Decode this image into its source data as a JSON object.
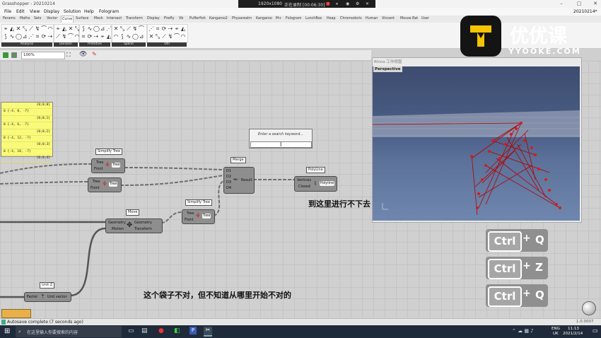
{
  "window": {
    "title": "Grasshopper - 20210214",
    "right_title": "20210214*"
  },
  "recording": {
    "resolution": "1920x1080",
    "status": "正在录制 [00:06:30]"
  },
  "menu": [
    "File",
    "Edit",
    "View",
    "Display",
    "Solution",
    "Help",
    "Fologram"
  ],
  "tabs": [
    "Params",
    "Maths",
    "Sets",
    "Vector",
    "Curve",
    "Surface",
    "Mesh",
    "Intersect",
    "Transform",
    "Display",
    "Firefly",
    "Vb",
    "Pufferfish",
    "Kangaroo2",
    "Physarealm",
    "Kangaroo",
    "M+",
    "Fologram",
    "LunchBox",
    "Heap",
    "Chromodoris",
    "Human",
    "Vincent",
    "Mouse Rat",
    "User"
  ],
  "active_tab": "Curve",
  "ribbon_groups": [
    "Analysis",
    "Division",
    "Primitive",
    "Spline",
    "Util"
  ],
  "zoom": "100%",
  "panel": {
    "rows": [
      {
        "path": "{0;0;0}",
        "value": "0 {-4, 0, -7}"
      },
      {
        "path": "{0;0;1}",
        "value": "0 {-4, 6, -7}"
      },
      {
        "path": "{0;0;2}",
        "value": "0 {-4, 12, -7}"
      },
      {
        "path": "{0;0;3}",
        "value": "0 {-4, 18, -7}"
      },
      {
        "path": "{0;0;4}",
        "value": ""
      }
    ]
  },
  "components": {
    "simplify1": {
      "name": "Simplify Tree",
      "in": [
        "Tree",
        "Front"
      ],
      "out": "Tree"
    },
    "tree2": {
      "in": [
        "Tree",
        "Front"
      ],
      "out": "Tree"
    },
    "simplify2": {
      "name": "Simplify Tree",
      "in": [
        "Tree",
        "Front"
      ],
      "out": "Tree"
    },
    "merge": {
      "name": "Merge",
      "in": [
        "D1",
        "D2",
        "D3",
        "D4"
      ],
      "out": "Result"
    },
    "polyline": {
      "name": "PolyLine",
      "in": [
        "Vertices",
        "Closed"
      ],
      "out": "Polyline"
    },
    "move": {
      "name": "Move",
      "in": [
        "Geometry",
        "Motion"
      ],
      "out": [
        "Geometry",
        "Transform"
      ]
    },
    "unitz": {
      "name": "Unit Z",
      "in": "Factor",
      "out": "Unit vector"
    }
  },
  "search": {
    "placeholder": "Enter a search keyword..."
  },
  "annotations": {
    "right": "到这里进行不下去",
    "bottom": "这个袋子不对，但不知道从哪里开始不对的"
  },
  "rhino": {
    "title": "Rhino 工作视窗",
    "viewport": "Perspective"
  },
  "logo": {
    "text": "优优课",
    "url": "YYOOKE.COM"
  },
  "shortcuts": [
    {
      "mod": "Ctrl",
      "plus": "+",
      "key": "Q"
    },
    {
      "mod": "Ctrl",
      "plus": "+",
      "key": "Z"
    },
    {
      "mod": "Ctrl",
      "plus": "+",
      "key": "Q"
    }
  ],
  "status": {
    "text": "Autosave complete (7 seconds ago)",
    "version": "1.0.0007"
  },
  "taskbar": {
    "search": "在这里输入你要搜索的内容",
    "lang": "ENG",
    "region": "UK",
    "time": "11:13",
    "date": "2021/2/14"
  },
  "colors": {
    "panel": "#fafa7a",
    "viewport": "#4d6089",
    "structure": "#b30000",
    "taskbar": "#1f2b3a"
  }
}
